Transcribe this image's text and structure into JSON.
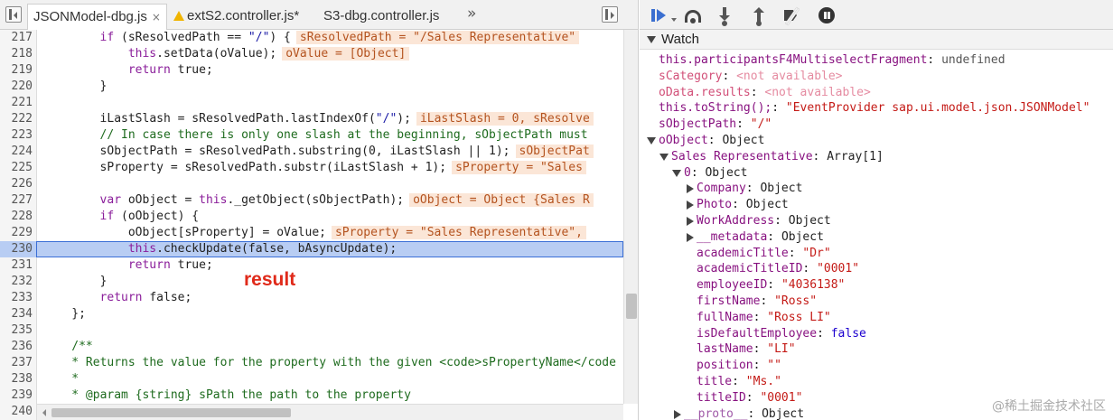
{
  "editor": {
    "tabs": [
      {
        "label": "JSONModel-dbg.js",
        "close": "×",
        "active": true,
        "warning": false
      },
      {
        "label": "extS2.controller.js*",
        "close": "",
        "active": false,
        "warning": true
      },
      {
        "label": "S3-dbg.controller.js",
        "close": "",
        "active": false,
        "warning": false
      }
    ],
    "more_glyph": "»",
    "result_label": "result",
    "highlighted_line": "230",
    "lines": [
      {
        "n": "217",
        "i": 8,
        "code": [
          {
            "t": "kw",
            "v": "if"
          },
          {
            "t": "p",
            "v": " (sResolvedPath == "
          },
          {
            "t": "st",
            "v": "\"/\""
          },
          {
            "t": "p",
            "v": ") {"
          }
        ],
        "ann": "sResolvedPath = \"/Sales Representative\""
      },
      {
        "n": "218",
        "i": 12,
        "code": [
          {
            "t": "kw",
            "v": "this"
          },
          {
            "t": "p",
            "v": ".setData(oValue);"
          }
        ],
        "ann": "oValue = [Object]"
      },
      {
        "n": "219",
        "i": 12,
        "code": [
          {
            "t": "kw",
            "v": "return"
          },
          {
            "t": "p",
            "v": " true;"
          }
        ],
        "ann": ""
      },
      {
        "n": "220",
        "i": 8,
        "code": [
          {
            "t": "p",
            "v": "}"
          }
        ],
        "ann": ""
      },
      {
        "n": "221",
        "i": 0,
        "code": [],
        "ann": ""
      },
      {
        "n": "222",
        "i": 8,
        "code": [
          {
            "t": "p",
            "v": "iLastSlash = sResolvedPath.lastIndexOf("
          },
          {
            "t": "st",
            "v": "\"/\""
          },
          {
            "t": "p",
            "v": ");"
          }
        ],
        "ann": "iLastSlash = 0, sResolve"
      },
      {
        "n": "223",
        "i": 8,
        "code": [
          {
            "t": "cm",
            "v": "// In case there is only one slash at the beginning, sObjectPath must"
          }
        ],
        "ann": ""
      },
      {
        "n": "224",
        "i": 8,
        "code": [
          {
            "t": "p",
            "v": "sObjectPath = sResolvedPath.substring(0, iLastSlash || 1);"
          }
        ],
        "ann": "sObjectPat"
      },
      {
        "n": "225",
        "i": 8,
        "code": [
          {
            "t": "p",
            "v": "sProperty = sResolvedPath.substr(iLastSlash + 1);"
          }
        ],
        "ann": "sProperty = \"Sales"
      },
      {
        "n": "226",
        "i": 0,
        "code": [],
        "ann": ""
      },
      {
        "n": "227",
        "i": 8,
        "code": [
          {
            "t": "kw",
            "v": "var"
          },
          {
            "t": "p",
            "v": " oObject = "
          },
          {
            "t": "kw",
            "v": "this"
          },
          {
            "t": "p",
            "v": "._getObject(sObjectPath);"
          }
        ],
        "ann": "oObject = Object {Sales R"
      },
      {
        "n": "228",
        "i": 8,
        "code": [
          {
            "t": "kw",
            "v": "if"
          },
          {
            "t": "p",
            "v": " (oObject) {"
          }
        ],
        "ann": ""
      },
      {
        "n": "229",
        "i": 12,
        "code": [
          {
            "t": "p",
            "v": "oObject[sProperty] = oValue;"
          }
        ],
        "ann": "sProperty = \"Sales Representative\","
      },
      {
        "n": "230",
        "i": 12,
        "code": [
          {
            "t": "kw",
            "v": "this"
          },
          {
            "t": "p",
            "v": ".checkUpdate(false, bAsyncUpdate);"
          }
        ],
        "ann": ""
      },
      {
        "n": "231",
        "i": 12,
        "code": [
          {
            "t": "kw",
            "v": "return"
          },
          {
            "t": "p",
            "v": " true;"
          }
        ],
        "ann": ""
      },
      {
        "n": "232",
        "i": 8,
        "code": [
          {
            "t": "p",
            "v": "}"
          }
        ],
        "ann": ""
      },
      {
        "n": "233",
        "i": 8,
        "code": [
          {
            "t": "kw",
            "v": "return"
          },
          {
            "t": "p",
            "v": " false;"
          }
        ],
        "ann": ""
      },
      {
        "n": "234",
        "i": 4,
        "code": [
          {
            "t": "p",
            "v": "};"
          }
        ],
        "ann": ""
      },
      {
        "n": "235",
        "i": 0,
        "code": [],
        "ann": ""
      },
      {
        "n": "236",
        "i": 4,
        "code": [
          {
            "t": "cm",
            "v": "/**"
          }
        ],
        "ann": ""
      },
      {
        "n": "237",
        "i": 4,
        "code": [
          {
            "t": "cm",
            "v": "* Returns the value for the property with the given <code>sPropertyName</code"
          }
        ],
        "ann": ""
      },
      {
        "n": "238",
        "i": 4,
        "code": [
          {
            "t": "cm",
            "v": "*"
          }
        ],
        "ann": ""
      },
      {
        "n": "239",
        "i": 4,
        "code": [
          {
            "t": "cm",
            "v": "* @param {string} sPath the path to the property"
          }
        ],
        "ann": ""
      },
      {
        "n": "240",
        "i": 4,
        "code": [
          {
            "t": "cm",
            "v": "* @param {object} [oContext=null] the context which will be used to retrie"
          }
        ],
        "ann": ""
      }
    ]
  },
  "debugger": {
    "watch_title": "Watch",
    "rows": [
      {
        "indent": 0,
        "toggle": "",
        "key": "this.participantsF4MultiselectFragment",
        "kind": "normal",
        "value": "undefined",
        "vkind": "dim"
      },
      {
        "indent": 0,
        "toggle": "",
        "key": "sCategory",
        "kind": "na",
        "value": "<not available>",
        "vkind": "na"
      },
      {
        "indent": 0,
        "toggle": "",
        "key": "oData.results",
        "kind": "na",
        "value": "<not available>",
        "vkind": "na"
      },
      {
        "indent": 0,
        "toggle": "",
        "key": "this.toString();",
        "kind": "normal",
        "value": "\"EventProvider sap.ui.model.json.JSONModel\"",
        "vkind": "str"
      },
      {
        "indent": 0,
        "toggle": "",
        "key": "sObjectPath",
        "kind": "normal",
        "value": "\"/\"",
        "vkind": "str"
      },
      {
        "indent": 0,
        "toggle": "open",
        "key": "oObject",
        "kind": "normal",
        "value": "Object",
        "vkind": "plain"
      },
      {
        "indent": 1,
        "toggle": "open",
        "key": "Sales Representative",
        "kind": "normal",
        "value": "Array[1]",
        "vkind": "plain"
      },
      {
        "indent": 2,
        "toggle": "open",
        "key": "0",
        "kind": "normal",
        "value": "Object",
        "vkind": "plain"
      },
      {
        "indent": 3,
        "toggle": "closed",
        "key": "Company",
        "kind": "normal",
        "value": "Object",
        "vkind": "plain"
      },
      {
        "indent": 3,
        "toggle": "closed",
        "key": "Photo",
        "kind": "normal",
        "value": "Object",
        "vkind": "plain"
      },
      {
        "indent": 3,
        "toggle": "closed",
        "key": "WorkAddress",
        "kind": "normal",
        "value": "Object",
        "vkind": "plain"
      },
      {
        "indent": 3,
        "toggle": "closed",
        "key": "__metadata",
        "kind": "normal",
        "value": "Object",
        "vkind": "plain"
      },
      {
        "indent": 3,
        "toggle": "",
        "key": "academicTitle",
        "kind": "normal",
        "value": "\"Dr\"",
        "vkind": "str"
      },
      {
        "indent": 3,
        "toggle": "",
        "key": "academicTitleID",
        "kind": "normal",
        "value": "\"0001\"",
        "vkind": "str"
      },
      {
        "indent": 3,
        "toggle": "",
        "key": "employeeID",
        "kind": "normal",
        "value": "\"4036138\"",
        "vkind": "str"
      },
      {
        "indent": 3,
        "toggle": "",
        "key": "firstName",
        "kind": "normal",
        "value": "\"Ross\"",
        "vkind": "str"
      },
      {
        "indent": 3,
        "toggle": "",
        "key": "fullName",
        "kind": "normal",
        "value": "\"Ross LI\"",
        "vkind": "str"
      },
      {
        "indent": 3,
        "toggle": "",
        "key": "isDefaultEmployee",
        "kind": "normal",
        "value": "false",
        "vkind": "bool"
      },
      {
        "indent": 3,
        "toggle": "",
        "key": "lastName",
        "kind": "normal",
        "value": "\"LI\"",
        "vkind": "str"
      },
      {
        "indent": 3,
        "toggle": "",
        "key": "position",
        "kind": "normal",
        "value": "\"\"",
        "vkind": "str"
      },
      {
        "indent": 3,
        "toggle": "",
        "key": "title",
        "kind": "normal",
        "value": "\"Ms.\"",
        "vkind": "str"
      },
      {
        "indent": 3,
        "toggle": "",
        "key": "titleID",
        "kind": "normal",
        "value": "\"0001\"",
        "vkind": "str"
      },
      {
        "indent": 2,
        "toggle": "closed",
        "key": "__proto__",
        "kind": "dimkey",
        "value": "Object",
        "vkind": "plain"
      }
    ]
  },
  "watermark": "@稀土掘金技术社区",
  "colors": {
    "highlight_line": "#b8cdf3",
    "annotation_bg": "#fbe6d7",
    "result_label": "#e02a1a",
    "resume_icon": "#3b6fd0"
  }
}
